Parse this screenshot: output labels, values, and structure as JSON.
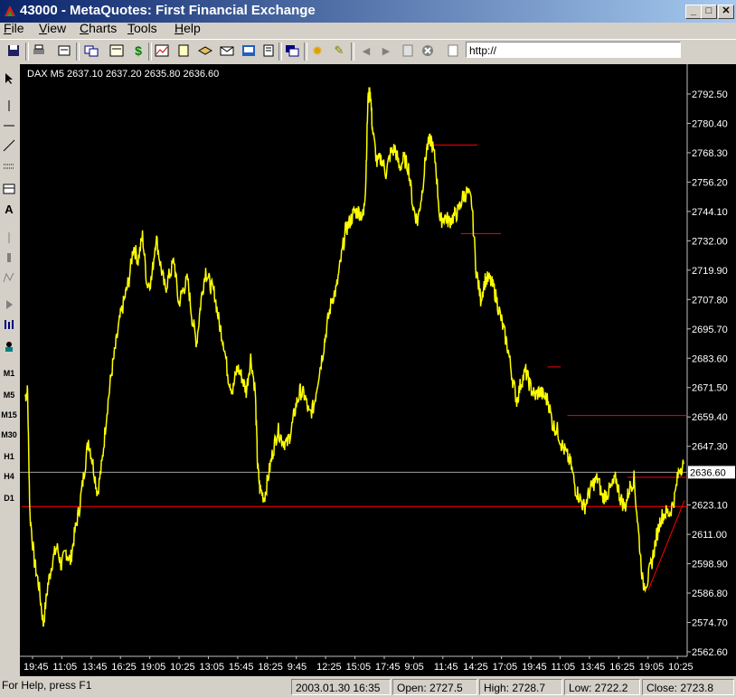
{
  "window": {
    "title": "43000 - MetaQuotes: First Financial Exchange",
    "min": "_",
    "max": "□",
    "close": "✕"
  },
  "menu": [
    "File",
    "View",
    "Charts",
    "Tools",
    "Help"
  ],
  "address": {
    "value": "http://"
  },
  "left_toolbar": {
    "text_tool": "A",
    "timeframes": [
      "M1",
      "M5",
      "M15",
      "M30",
      "H1",
      "H4",
      "D1"
    ]
  },
  "chart_data": {
    "type": "line",
    "symbol_header": "DAX M5  2637.10  2637.20  2635.80  2636.60",
    "line_color": "#ffff00",
    "background": "#000000",
    "y_ticks": [
      "2792.50",
      "2780.40",
      "2768.30",
      "2756.20",
      "2744.10",
      "2732.00",
      "2719.90",
      "2707.80",
      "2695.70",
      "2683.60",
      "2671.50",
      "2659.40",
      "2647.30",
      "2623.10",
      "2611.00",
      "2598.90",
      "2586.80",
      "2574.70",
      "2562.60"
    ],
    "ylim": [
      2560,
      2798
    ],
    "x_ticks": [
      "19:45",
      "11:05",
      "13:45",
      "16:25",
      "19:05",
      "10:25",
      "13:05",
      "15:45",
      "18:25",
      "9:45",
      "12:25",
      "15:05",
      "17:45",
      "9:05",
      "11:45",
      "14:25",
      "17:05",
      "19:45",
      "11:05",
      "13:45",
      "16:25",
      "19:05",
      "10:25"
    ],
    "current_price": "2636.60",
    "key_points": [
      [
        0,
        2668
      ],
      [
        2,
        2670
      ],
      [
        4,
        2620
      ],
      [
        8,
        2600
      ],
      [
        12,
        2590
      ],
      [
        16,
        2574
      ],
      [
        20,
        2590
      ],
      [
        24,
        2600
      ],
      [
        28,
        2606
      ],
      [
        32,
        2598
      ],
      [
        36,
        2604
      ],
      [
        40,
        2600
      ],
      [
        44,
        2612
      ],
      [
        48,
        2622
      ],
      [
        52,
        2636
      ],
      [
        56,
        2650
      ],
      [
        60,
        2640
      ],
      [
        64,
        2628
      ],
      [
        68,
        2640
      ],
      [
        72,
        2660
      ],
      [
        76,
        2676
      ],
      [
        80,
        2688
      ],
      [
        84,
        2700
      ],
      [
        88,
        2708
      ],
      [
        92,
        2716
      ],
      [
        96,
        2730
      ],
      [
        100,
        2724
      ],
      [
        104,
        2734
      ],
      [
        108,
        2714
      ],
      [
        112,
        2716
      ],
      [
        116,
        2734
      ],
      [
        120,
        2722
      ],
      [
        124,
        2712
      ],
      [
        128,
        2718
      ],
      [
        132,
        2724
      ],
      [
        136,
        2706
      ],
      [
        140,
        2712
      ],
      [
        144,
        2716
      ],
      [
        148,
        2700
      ],
      [
        152,
        2690
      ],
      [
        156,
        2708
      ],
      [
        160,
        2720
      ],
      [
        164,
        2714
      ],
      [
        168,
        2710
      ],
      [
        172,
        2698
      ],
      [
        176,
        2690
      ],
      [
        180,
        2676
      ],
      [
        184,
        2670
      ],
      [
        188,
        2680
      ],
      [
        192,
        2676
      ],
      [
        196,
        2670
      ],
      [
        200,
        2684
      ],
      [
        204,
        2670
      ],
      [
        206,
        2640
      ],
      [
        208,
        2630
      ],
      [
        212,
        2626
      ],
      [
        216,
        2636
      ],
      [
        220,
        2646
      ],
      [
        224,
        2654
      ],
      [
        228,
        2650
      ],
      [
        232,
        2648
      ],
      [
        236,
        2654
      ],
      [
        240,
        2664
      ],
      [
        244,
        2670
      ],
      [
        248,
        2668
      ],
      [
        252,
        2660
      ],
      [
        256,
        2664
      ],
      [
        260,
        2676
      ],
      [
        264,
        2686
      ],
      [
        268,
        2698
      ],
      [
        272,
        2708
      ],
      [
        276,
        2712
      ],
      [
        280,
        2724
      ],
      [
        284,
        2736
      ],
      [
        288,
        2740
      ],
      [
        292,
        2744
      ],
      [
        296,
        2744
      ],
      [
        300,
        2742
      ],
      [
        302,
        2756
      ],
      [
        304,
        2790
      ],
      [
        306,
        2794
      ],
      [
        308,
        2778
      ],
      [
        312,
        2764
      ],
      [
        316,
        2766
      ],
      [
        320,
        2760
      ],
      [
        324,
        2768
      ],
      [
        328,
        2770
      ],
      [
        332,
        2762
      ],
      [
        336,
        2766
      ],
      [
        340,
        2762
      ],
      [
        344,
        2746
      ],
      [
        348,
        2740
      ],
      [
        352,
        2752
      ],
      [
        356,
        2770
      ],
      [
        360,
        2774
      ],
      [
        364,
        2764
      ],
      [
        368,
        2740
      ],
      [
        372,
        2742
      ],
      [
        376,
        2740
      ],
      [
        380,
        2742
      ],
      [
        384,
        2744
      ],
      [
        388,
        2750
      ],
      [
        392,
        2752
      ],
      [
        396,
        2748
      ],
      [
        400,
        2720
      ],
      [
        404,
        2708
      ],
      [
        408,
        2716
      ],
      [
        412,
        2716
      ],
      [
        416,
        2712
      ],
      [
        420,
        2704
      ],
      [
        424,
        2696
      ],
      [
        428,
        2688
      ],
      [
        432,
        2676
      ],
      [
        436,
        2666
      ],
      [
        440,
        2674
      ],
      [
        444,
        2678
      ],
      [
        448,
        2672
      ],
      [
        452,
        2668
      ],
      [
        456,
        2670
      ],
      [
        460,
        2668
      ],
      [
        464,
        2666
      ],
      [
        468,
        2656
      ],
      [
        472,
        2654
      ],
      [
        476,
        2648
      ],
      [
        480,
        2644
      ],
      [
        484,
        2640
      ],
      [
        488,
        2630
      ],
      [
        492,
        2626
      ],
      [
        496,
        2622
      ],
      [
        500,
        2628
      ],
      [
        504,
        2632
      ],
      [
        508,
        2634
      ],
      [
        512,
        2626
      ],
      [
        516,
        2628
      ],
      [
        520,
        2630
      ],
      [
        524,
        2634
      ],
      [
        528,
        2626
      ],
      [
        532,
        2622
      ],
      [
        536,
        2630
      ],
      [
        540,
        2634
      ],
      [
        544,
        2612
      ],
      [
        548,
        2590
      ],
      [
        552,
        2592
      ],
      [
        556,
        2600
      ],
      [
        560,
        2610
      ],
      [
        564,
        2618
      ],
      [
        568,
        2620
      ],
      [
        572,
        2620
      ],
      [
        576,
        2626
      ],
      [
        580,
        2638
      ],
      [
        584,
        2640
      ]
    ],
    "hlines": [
      {
        "y": 2622.5,
        "x_from": 0,
        "x_to": 1
      },
      {
        "y": 2660.0,
        "x_from": 0.82,
        "x_to": 1
      },
      {
        "y": 2634.5,
        "x_from": 0.91,
        "x_to": 1
      }
    ],
    "drawn_objects": [
      {
        "y": 2771.5,
        "from": 0.615,
        "to": 0.685
      },
      {
        "y": 2735.0,
        "from": 0.66,
        "to": 0.72
      },
      {
        "y": 2680.0,
        "from": 0.79,
        "to": 0.81
      }
    ],
    "gray_line": 2636.6
  },
  "status": {
    "help": "For Help, press F1",
    "datetime": "2003.01.30 16:35",
    "open": "Open: 2727.5",
    "high": "High: 2728.7",
    "low": "Low: 2722.2",
    "close": "Close: 2723.8"
  }
}
